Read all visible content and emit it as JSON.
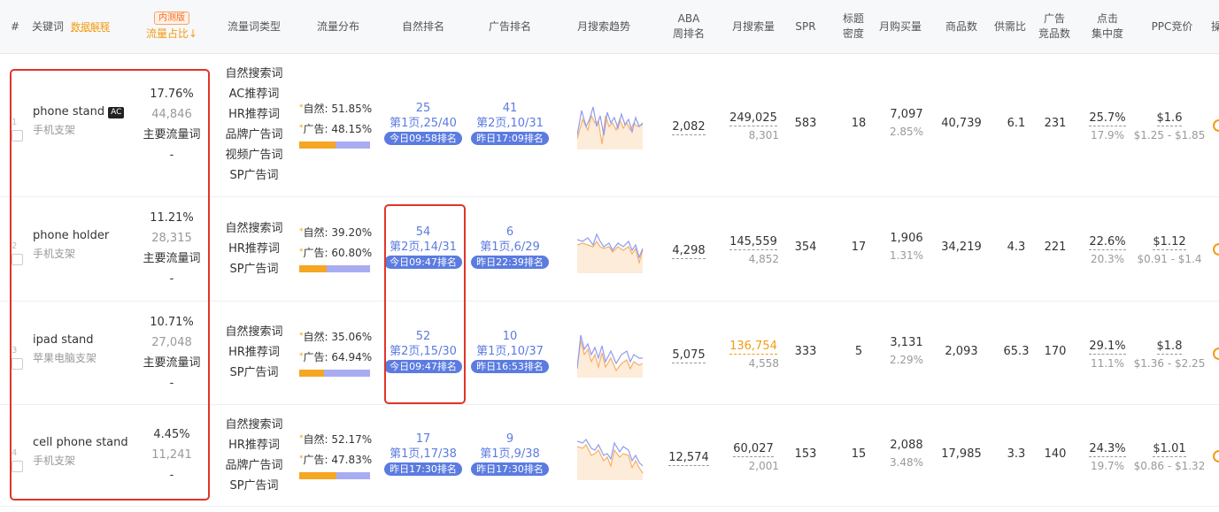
{
  "header": {
    "col_index": "#",
    "col_keyword": "关键词",
    "data_explain_link": "数据解释",
    "beta_badge": "内测版",
    "col_traffic_share": "流量占比↓",
    "col_traffic_type": "流量词类型",
    "col_traffic_dist": "流量分布",
    "col_natural_rank": "自然排名",
    "col_ad_rank": "广告排名",
    "col_trend": "月搜索趋势",
    "col_aba_1": "ABA",
    "col_aba_2": "周排名",
    "col_monthly_search": "月搜索量",
    "col_spr": "SPR",
    "col_title_density_1": "标题",
    "col_title_density_2": "密度",
    "col_monthly_purchase": "月购买量",
    "col_product_count": "商品数",
    "col_supply_demand": "供需比",
    "col_ad_competitors_1": "广告",
    "col_ad_competitors_2": "竞品数",
    "col_click_conc_1": "点击",
    "col_click_conc_2": "集中度",
    "col_ppc": "PPC竞价",
    "col_action_cut": "操"
  },
  "dist_labels": {
    "natural": "自然:",
    "ad": "广告:"
  },
  "colors": {
    "natural_bar": "#f5a623",
    "ad_bar": "#a8adf2",
    "rank_pill": "#5b7be0",
    "highlight_box": "#e0352b"
  },
  "rows": [
    {
      "index": "1",
      "keyword": "phone stand",
      "keyword_badge": "AC",
      "translation": "手机支架",
      "share_pct": "17.76%",
      "share_value": "44,846",
      "share_label": "主要流量词",
      "share_dash": "-",
      "types": [
        "自然搜索词",
        "AC推荐词",
        "HR推荐词",
        "品牌广告词",
        "视频广告词",
        "SP广告词"
      ],
      "natural_pct": "51.85%",
      "ad_pct": "48.15%",
      "natural_share": 0.5185,
      "natural_rank": "25",
      "natural_page": "第1页,25/40",
      "natural_time": "今日09:58排名",
      "ad_rank": "41",
      "ad_page": "第2页,10/31",
      "ad_time": "昨日17:09排名",
      "aba_rank": "2,082",
      "monthly_search": "249,025",
      "monthly_search_sub": "8,301",
      "spr": "583",
      "title_density": "18",
      "monthly_purchase": "7,097",
      "purchase_rate": "2.85%",
      "product_count": "40,739",
      "supply_demand": "6.1",
      "ad_competitors": "231",
      "click_conc": "25.7%",
      "click_conc_sub": "17.9%",
      "ppc": "$1.6",
      "ppc_range": "$1.25 - $1.85"
    },
    {
      "index": "2",
      "keyword": "phone holder",
      "keyword_badge": "",
      "translation": "手机支架",
      "share_pct": "11.21%",
      "share_value": "28,315",
      "share_label": "主要流量词",
      "share_dash": "-",
      "types": [
        "自然搜索词",
        "HR推荐词",
        "SP广告词"
      ],
      "natural_pct": "39.20%",
      "ad_pct": "60.80%",
      "natural_share": 0.392,
      "natural_rank": "54",
      "natural_page": "第2页,14/31",
      "natural_time": "今日09:47排名",
      "ad_rank": "6",
      "ad_page": "第1页,6/29",
      "ad_time": "昨日22:39排名",
      "aba_rank": "4,298",
      "monthly_search": "145,559",
      "monthly_search_sub": "4,852",
      "spr": "354",
      "title_density": "17",
      "monthly_purchase": "1,906",
      "purchase_rate": "1.31%",
      "product_count": "34,219",
      "supply_demand": "4.3",
      "ad_competitors": "221",
      "click_conc": "22.6%",
      "click_conc_sub": "20.3%",
      "ppc": "$1.12",
      "ppc_range": "$0.91 - $1.4"
    },
    {
      "index": "3",
      "keyword": "ipad stand",
      "keyword_badge": "",
      "translation": "苹果电脑支架",
      "share_pct": "10.71%",
      "share_value": "27,048",
      "share_label": "主要流量词",
      "share_dash": "-",
      "types": [
        "自然搜索词",
        "HR推荐词",
        "SP广告词"
      ],
      "natural_pct": "35.06%",
      "ad_pct": "64.94%",
      "natural_share": 0.3506,
      "natural_rank": "52",
      "natural_page": "第2页,15/30",
      "natural_time": "今日09:47排名",
      "ad_rank": "10",
      "ad_page": "第1页,10/37",
      "ad_time": "昨日16:53排名",
      "aba_rank": "5,075",
      "monthly_search": "136,754",
      "monthly_search_sub": "4,558",
      "spr": "333",
      "title_density": "5",
      "monthly_purchase": "3,131",
      "purchase_rate": "2.29%",
      "product_count": "2,093",
      "supply_demand": "65.3",
      "ad_competitors": "170",
      "click_conc": "29.1%",
      "click_conc_sub": "11.1%",
      "ppc": "$1.8",
      "ppc_range": "$1.36 - $2.25"
    },
    {
      "index": "4",
      "keyword": "cell phone stand",
      "keyword_badge": "",
      "translation": "手机支架",
      "share_pct": "4.45%",
      "share_value": "11,241",
      "share_label": "",
      "share_dash": "-",
      "types": [
        "自然搜索词",
        "HR推荐词",
        "品牌广告词",
        "SP广告词"
      ],
      "natural_pct": "52.17%",
      "ad_pct": "47.83%",
      "natural_share": 0.5217,
      "natural_rank": "17",
      "natural_page": "第1页,17/38",
      "natural_time": "昨日17:30排名",
      "ad_rank": "9",
      "ad_page": "第1页,9/38",
      "ad_time": "昨日17:30排名",
      "aba_rank": "12,574",
      "monthly_search": "60,027",
      "monthly_search_sub": "2,001",
      "spr": "153",
      "title_density": "15",
      "monthly_purchase": "2,088",
      "purchase_rate": "3.48%",
      "product_count": "17,985",
      "supply_demand": "3.3",
      "ad_competitors": "140",
      "click_conc": "24.3%",
      "click_conc_sub": "19.7%",
      "ppc": "$1.01",
      "ppc_range": "$0.86 - $1.32"
    }
  ]
}
